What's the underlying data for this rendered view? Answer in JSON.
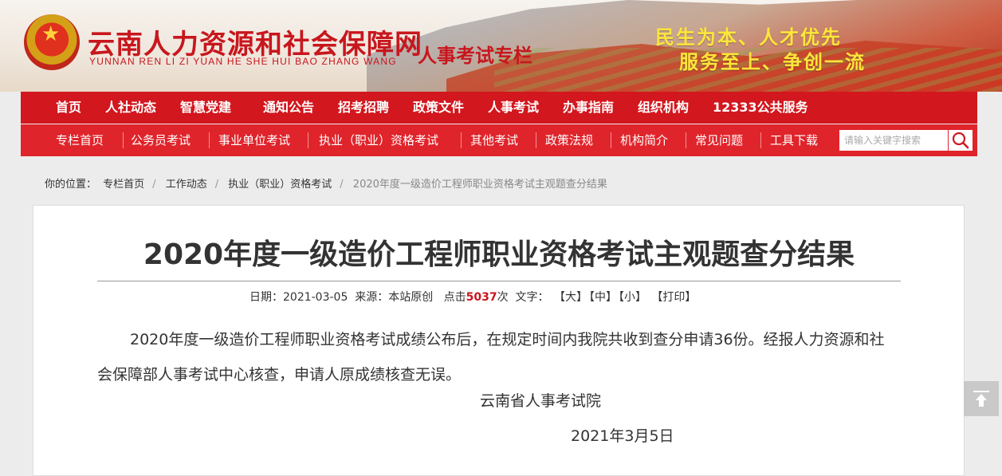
{
  "header": {
    "site_title": "云南人力资源和社会保障网",
    "site_pinyin": "YUNNAN REN LI ZI YUAN HE SHE HUI BAO ZHANG WANG",
    "column_name": "人事考试专栏",
    "slogan_line1": "民生为本、人才优先",
    "slogan_line2": "服务至上、争创一流",
    "emblem_icon": "national-emblem-icon"
  },
  "main_nav": {
    "items": [
      {
        "label": "首页"
      },
      {
        "label": "人社动态"
      },
      {
        "label": "智慧党建"
      },
      {
        "label": "通知公告"
      },
      {
        "label": "招考招聘"
      },
      {
        "label": "政策文件"
      },
      {
        "label": "人事考试"
      },
      {
        "label": "办事指南"
      },
      {
        "label": "组织机构"
      },
      {
        "label": "12333公共服务"
      }
    ]
  },
  "sub_nav": {
    "items": [
      {
        "label": "专栏首页"
      },
      {
        "label": "公务员考试"
      },
      {
        "label": "事业单位考试"
      },
      {
        "label": "执业（职业）资格考试"
      },
      {
        "label": "其他考试"
      },
      {
        "label": "政策法规"
      },
      {
        "label": "机构简介"
      },
      {
        "label": "常见问题"
      },
      {
        "label": "工具下载"
      }
    ],
    "search_placeholder": "请输入关键字搜索"
  },
  "breadcrumb": {
    "prefix": "你的位置：",
    "items": [
      "专栏首页",
      "工作动态",
      "执业（职业）资格考试"
    ],
    "current": "2020年度一级造价工程师职业资格考试主观题查分结果"
  },
  "article": {
    "title": "2020年度一级造价工程师职业资格考试主观题查分结果",
    "meta": {
      "date_label": "日期：",
      "date": "2021-03-05",
      "source_label": "来源：",
      "source": "本站原创",
      "hits_label": "点击",
      "hits": "5037",
      "hits_unit": "次",
      "font_label": "文字：",
      "font_large": "【大】",
      "font_medium": "【中】",
      "font_small": "【小】",
      "print": "【打印】"
    },
    "body": "2020年度一级造价工程师职业资格考试成绩公布后，在规定时间内我院共收到查分申请36份。经报人力资源和社会保障部人事考试中心核查，申请人原成绩核查无误。",
    "signature": "云南省人事考试院",
    "date": "2021年3月5日"
  },
  "colors": {
    "brand_red": "#d2171e",
    "subnav_red": "#e0242b",
    "slogan_yellow": "#ffe63a"
  }
}
